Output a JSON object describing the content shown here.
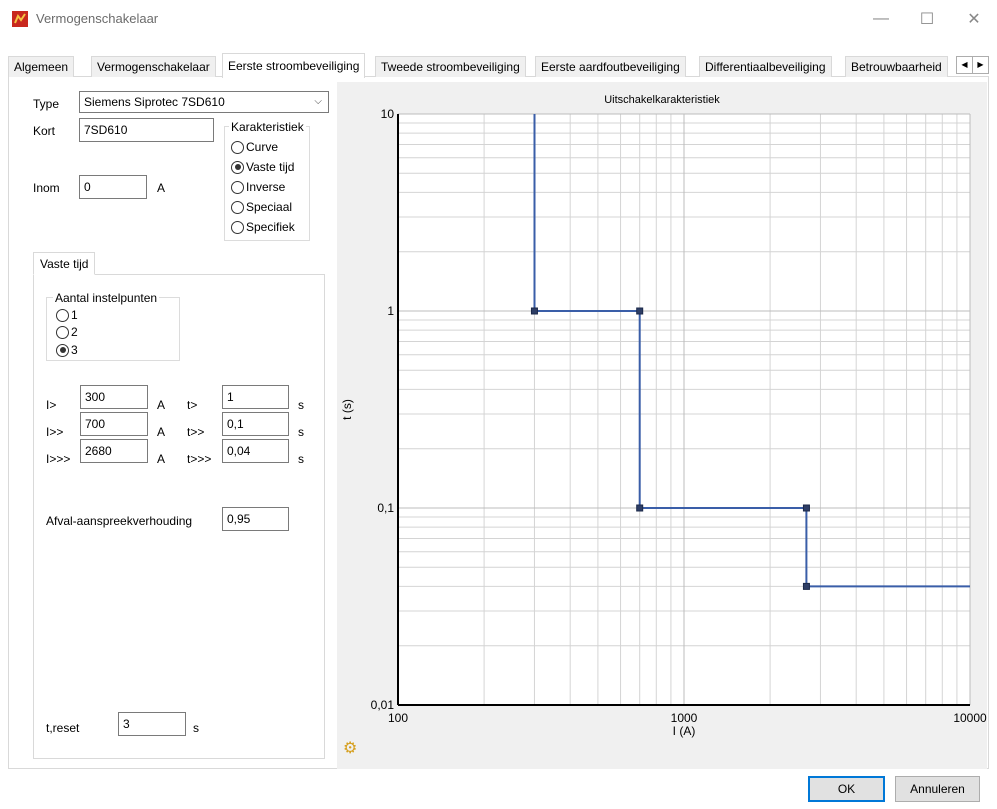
{
  "window": {
    "title": "Vermogenschakelaar",
    "min_glyph": "—",
    "max_glyph": "☐",
    "close_glyph": "✕"
  },
  "tabs": [
    {
      "label": "Algemeen",
      "active": false
    },
    {
      "label": "Vermogenschakelaar",
      "active": false
    },
    {
      "label": "Eerste stroombeveiliging",
      "active": true
    },
    {
      "label": "Tweede stroombeveiliging",
      "active": false
    },
    {
      "label": "Eerste aardfoutbeveiliging",
      "active": false
    },
    {
      "label": "Differentiaalbeveiliging",
      "active": false
    },
    {
      "label": "Betrouwbaarheid",
      "active": false
    }
  ],
  "tab_scroll": {
    "left": "◀",
    "right": "▶"
  },
  "form": {
    "type_label": "Type",
    "type_value": "Siemens Siprotec 7SD610",
    "kort_label": "Kort",
    "kort_value": "7SD610",
    "inom_label": "Inom",
    "inom_value": "0",
    "inom_unit": "A",
    "karakteristiek": {
      "title": "Karakteristiek",
      "options": [
        {
          "label": "Curve",
          "checked": false
        },
        {
          "label": "Vaste tijd",
          "checked": true
        },
        {
          "label": "Inverse",
          "checked": false
        },
        {
          "label": "Speciaal",
          "checked": false
        },
        {
          "label": "Specifiek",
          "checked": false
        }
      ]
    },
    "subtab_label": "Vaste tijd",
    "instelpunten": {
      "title": "Aantal instelpunten",
      "options": [
        {
          "label": "1",
          "checked": false
        },
        {
          "label": "2",
          "checked": false
        },
        {
          "label": "3",
          "checked": true
        }
      ]
    },
    "settings": [
      {
        "i_label": "I>",
        "i_value": "300",
        "i_unit": "A",
        "t_label": "t>",
        "t_value": "1",
        "t_unit": "s"
      },
      {
        "i_label": "I>>",
        "i_value": "700",
        "i_unit": "A",
        "t_label": "t>>",
        "t_value": "0,1",
        "t_unit": "s"
      },
      {
        "i_label": "I>>>",
        "i_value": "2680",
        "i_unit": "A",
        "t_label": "t>>>",
        "t_value": "0,04",
        "t_unit": "s"
      }
    ],
    "afval_label": "Afval-aanspreekverhouding",
    "afval_value": "0,95",
    "treset_label": "t,reset",
    "treset_value": "3",
    "treset_unit": "s"
  },
  "chart_data": {
    "type": "line",
    "title": "Uitschakelkarakteristiek",
    "xlabel": "I (A)",
    "ylabel": "t (s)",
    "x_scale": "log",
    "y_scale": "log",
    "xlim": [
      100,
      10000
    ],
    "ylim": [
      0.01,
      10
    ],
    "x_ticks": [
      {
        "value": 100,
        "label": "100"
      },
      {
        "value": 1000,
        "label": "1000"
      },
      {
        "value": 10000,
        "label": "10000"
      }
    ],
    "y_ticks": [
      {
        "value": 10,
        "label": "10"
      },
      {
        "value": 1,
        "label": "1"
      },
      {
        "value": 0.1,
        "label": "0,1"
      },
      {
        "value": 0.01,
        "label": "0,01"
      }
    ],
    "grid": true,
    "line_color": "#3a5ea8",
    "series": [
      {
        "points": [
          [
            300,
            10
          ],
          [
            300,
            1
          ],
          [
            700,
            1
          ],
          [
            700,
            0.1
          ],
          [
            2680,
            0.1
          ],
          [
            2680,
            0.04
          ],
          [
            10000,
            0.04
          ]
        ],
        "markers": [
          [
            300,
            1
          ],
          [
            700,
            1
          ],
          [
            700,
            0.1
          ],
          [
            2680,
            0.1
          ],
          [
            2680,
            0.04
          ]
        ]
      }
    ]
  },
  "buttons": {
    "ok": "OK",
    "cancel": "Annuleren"
  }
}
